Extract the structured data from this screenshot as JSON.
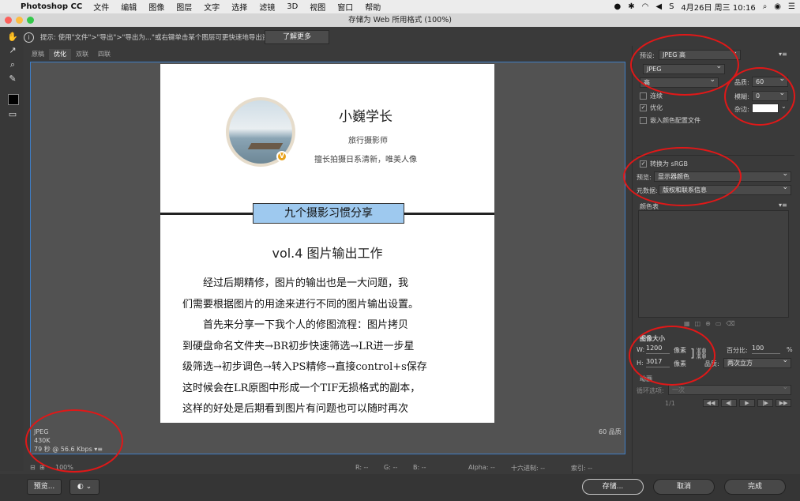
{
  "menubar": {
    "app_name": "Photoshop CC",
    "items": [
      "文件",
      "编辑",
      "图像",
      "图层",
      "文字",
      "选择",
      "滤镜",
      "3D",
      "视图",
      "窗口",
      "帮助"
    ],
    "datetime": "4月26日 周三 10:16"
  },
  "window": {
    "title": "存储为 Web 所用格式 (100%)"
  },
  "hint": {
    "text": "提示: 使用\"文件\">\"导出\">\"导出为...\"或右键单击某个图层可更快速地导出资源",
    "learn_more": "了解更多"
  },
  "view_tabs": [
    "原稿",
    "优化",
    "双联",
    "四联"
  ],
  "doc": {
    "name": "小巍学长",
    "role": "旅行摄影师",
    "motto": "擅长拍摄日系清新，唯美人像",
    "badge": "V",
    "banner": "九个摄影习惯分享",
    "vol_title": "vol.4  图片输出工作",
    "paragraph_lines": [
      "　　经过后期精修，图片的输出也是一大问题，我",
      "们需要根据图片的用途来进行不同的图片输出设置。",
      "　　首先来分享一下我个人的修图流程：图片拷贝",
      "到硬盘命名文件夹→BR初步快速筛选→LR进一步星",
      "级筛选→初步调色→转入PS精修→直接control+s保存",
      "这时候会在LR原图中形成一个TIF无损格式的副本，",
      "这样的好处是后期看到图片有问题也可以随时再次"
    ]
  },
  "info": {
    "format": "JPEG",
    "size": "430K",
    "time": "79 秒 @ 56.6 Kbps",
    "quality_label": "60 品质"
  },
  "status": {
    "zoom": "100%",
    "r": "R: --",
    "g": "G: --",
    "b": "B: --",
    "alpha": "Alpha: --",
    "hex": "十六进制: --",
    "index": "索引: --"
  },
  "buttons": {
    "preview": "预览...",
    "save": "存储...",
    "cancel": "取消",
    "done": "完成"
  },
  "panel": {
    "preset_label": "预设:",
    "preset_value": "JPEG 高",
    "format_value": "JPEG",
    "compression_value": "高",
    "quality_label": "品质:",
    "quality_value": "60",
    "blur_label": "模糊:",
    "blur_value": "0",
    "matte_label": "杂边:",
    "progressive": "连续",
    "optimized": "优化",
    "embed_profile": "嵌入颜色配置文件",
    "convert_srgb": "转换为 sRGB",
    "preview_label": "预览:",
    "preview_value": "显示器颜色",
    "metadata_label": "元数据:",
    "metadata_value": "版权和联系信息",
    "color_table": "颜色表",
    "image_size": "图像大小",
    "w_label": "W:",
    "w_value": "1200",
    "h_label": "H:",
    "h_value": "3017",
    "px": "像素",
    "percent_label": "百分比:",
    "percent_value": "100",
    "percent_unit": "%",
    "quality2_label": "品质:",
    "resample_value": "两次立方",
    "animation": "动画",
    "loop_label": "循环选项:",
    "loop_value": "一次",
    "frame": "1/1"
  },
  "colors": {
    "accent": "#3f7dc5",
    "annotation": "#e01818",
    "banner": "#9ec9ef"
  }
}
